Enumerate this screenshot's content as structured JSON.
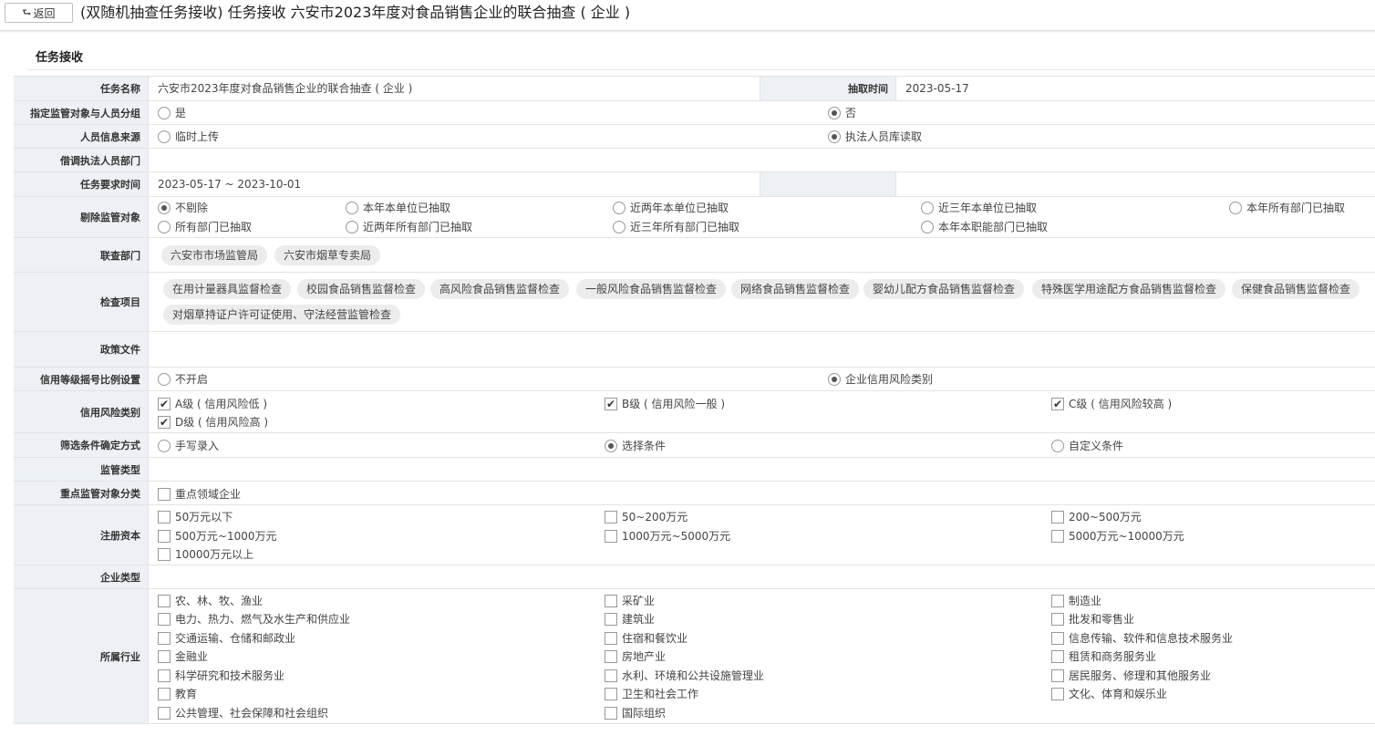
{
  "header": {
    "back_label": "返回",
    "back_icon": "return-arrow-icon",
    "title": "(双随机抽查任务接收) 任务接收 六安市2023年度对食品销售企业的联合抽查 ( 企业 )"
  },
  "section": {
    "title": "任务接收"
  },
  "task": {
    "name_label": "任务名称",
    "name_value": "六安市2023年度对食品销售企业的联合抽查 ( 企业 )",
    "draw_time_label": "抽取时间",
    "draw_time_value": "2023-05-17"
  },
  "group": {
    "label": "指定监管对象与人员分组",
    "options": [
      {
        "text": "是",
        "checked": false
      },
      {
        "text": "否",
        "checked": true
      }
    ]
  },
  "source": {
    "label": "人员信息来源",
    "options": [
      {
        "text": "临时上传",
        "checked": false
      },
      {
        "text": "执法人员库读取",
        "checked": true
      }
    ]
  },
  "borrow": {
    "label": "借调执法人员部门",
    "value": ""
  },
  "period": {
    "label": "任务要求时间",
    "value": "2023-05-17 ~ 2023-10-01"
  },
  "exclude": {
    "label": "剔除监管对象",
    "options": [
      {
        "text": "不剔除",
        "checked": true
      },
      {
        "text": "本年本单位已抽取",
        "checked": false
      },
      {
        "text": "近两年本单位已抽取",
        "checked": false
      },
      {
        "text": "近三年本单位已抽取",
        "checked": false
      },
      {
        "text": "本年所有部门已抽取",
        "checked": false
      },
      {
        "text": "所有部门已抽取",
        "checked": false
      },
      {
        "text": "近两年所有部门已抽取",
        "checked": false
      },
      {
        "text": "近三年所有部门已抽取",
        "checked": false
      },
      {
        "text": "本年本职能部门已抽取",
        "checked": false
      }
    ]
  },
  "joint": {
    "label": "联查部门",
    "chips": [
      "六安市市场监管局",
      "六安市烟草专卖局"
    ]
  },
  "items": {
    "label": "检查项目",
    "chips": [
      "在用计量器具监督检查",
      "校园食品销售监督检查",
      "高风险食品销售监督检查",
      "一般风险食品销售监督检查",
      "网络食品销售监督检查",
      "婴幼儿配方食品销售监督检查",
      "特殊医学用途配方食品销售监督检查",
      "保健食品销售监督检查",
      "对烟草持证户许可证使用、守法经营监管检查"
    ]
  },
  "policy": {
    "label": "政策文件",
    "value": ""
  },
  "credit_setting": {
    "label": "信用等级摇号比例设置",
    "options": [
      {
        "text": "不开启",
        "checked": false
      },
      {
        "text": "企业信用风险类别",
        "checked": true
      }
    ]
  },
  "credit_risk": {
    "label": "信用风险类别",
    "options": [
      {
        "text": "A级 ( 信用风险低 )",
        "checked": true
      },
      {
        "text": "B级 ( 信用风险一般 )",
        "checked": true
      },
      {
        "text": "C级 ( 信用风险较高 )",
        "checked": true
      },
      {
        "text": "D级 ( 信用风险高 )",
        "checked": true
      }
    ]
  },
  "filter_mode": {
    "label": "筛选条件确定方式",
    "options": [
      {
        "text": "手写录入",
        "checked": false
      },
      {
        "text": "选择条件",
        "checked": true
      },
      {
        "text": "自定义条件",
        "checked": false
      }
    ]
  },
  "supervision_type": {
    "label": "监管类型",
    "value": ""
  },
  "key_category": {
    "label": "重点监管对象分类",
    "options": [
      {
        "text": "重点领域企业",
        "checked": false
      }
    ]
  },
  "capital": {
    "label": "注册资本",
    "options": [
      {
        "text": "50万元以下",
        "checked": false
      },
      {
        "text": "50~200万元",
        "checked": false
      },
      {
        "text": "200~500万元",
        "checked": false
      },
      {
        "text": "500万元~1000万元",
        "checked": false
      },
      {
        "text": "1000万元~5000万元",
        "checked": false
      },
      {
        "text": "5000万元~10000万元",
        "checked": false
      },
      {
        "text": "10000万元以上",
        "checked": false
      }
    ]
  },
  "enterprise_type": {
    "label": "企业类型",
    "value": ""
  },
  "industry": {
    "label": "所属行业",
    "options": [
      {
        "text": "农、林、牧、渔业",
        "checked": false
      },
      {
        "text": "采矿业",
        "checked": false
      },
      {
        "text": "制造业",
        "checked": false
      },
      {
        "text": "电力、热力、燃气及水生产和供应业",
        "checked": false
      },
      {
        "text": "建筑业",
        "checked": false
      },
      {
        "text": "批发和零售业",
        "checked": false
      },
      {
        "text": "交通运输、仓储和邮政业",
        "checked": false
      },
      {
        "text": "住宿和餐饮业",
        "checked": false
      },
      {
        "text": "信息传输、软件和信息技术服务业",
        "checked": false
      },
      {
        "text": "金融业",
        "checked": false
      },
      {
        "text": "房地产业",
        "checked": false
      },
      {
        "text": "租赁和商务服务业",
        "checked": false
      },
      {
        "text": "科学研究和技术服务业",
        "checked": false
      },
      {
        "text": "水利、环境和公共设施管理业",
        "checked": false
      },
      {
        "text": "居民服务、修理和其他服务业",
        "checked": false
      },
      {
        "text": "教育",
        "checked": false
      },
      {
        "text": "卫生和社会工作",
        "checked": false
      },
      {
        "text": "文化、体育和娱乐业",
        "checked": false
      },
      {
        "text": "公共管理、社会保障和社会组织",
        "checked": false
      },
      {
        "text": "国际组织",
        "checked": false
      }
    ]
  }
}
